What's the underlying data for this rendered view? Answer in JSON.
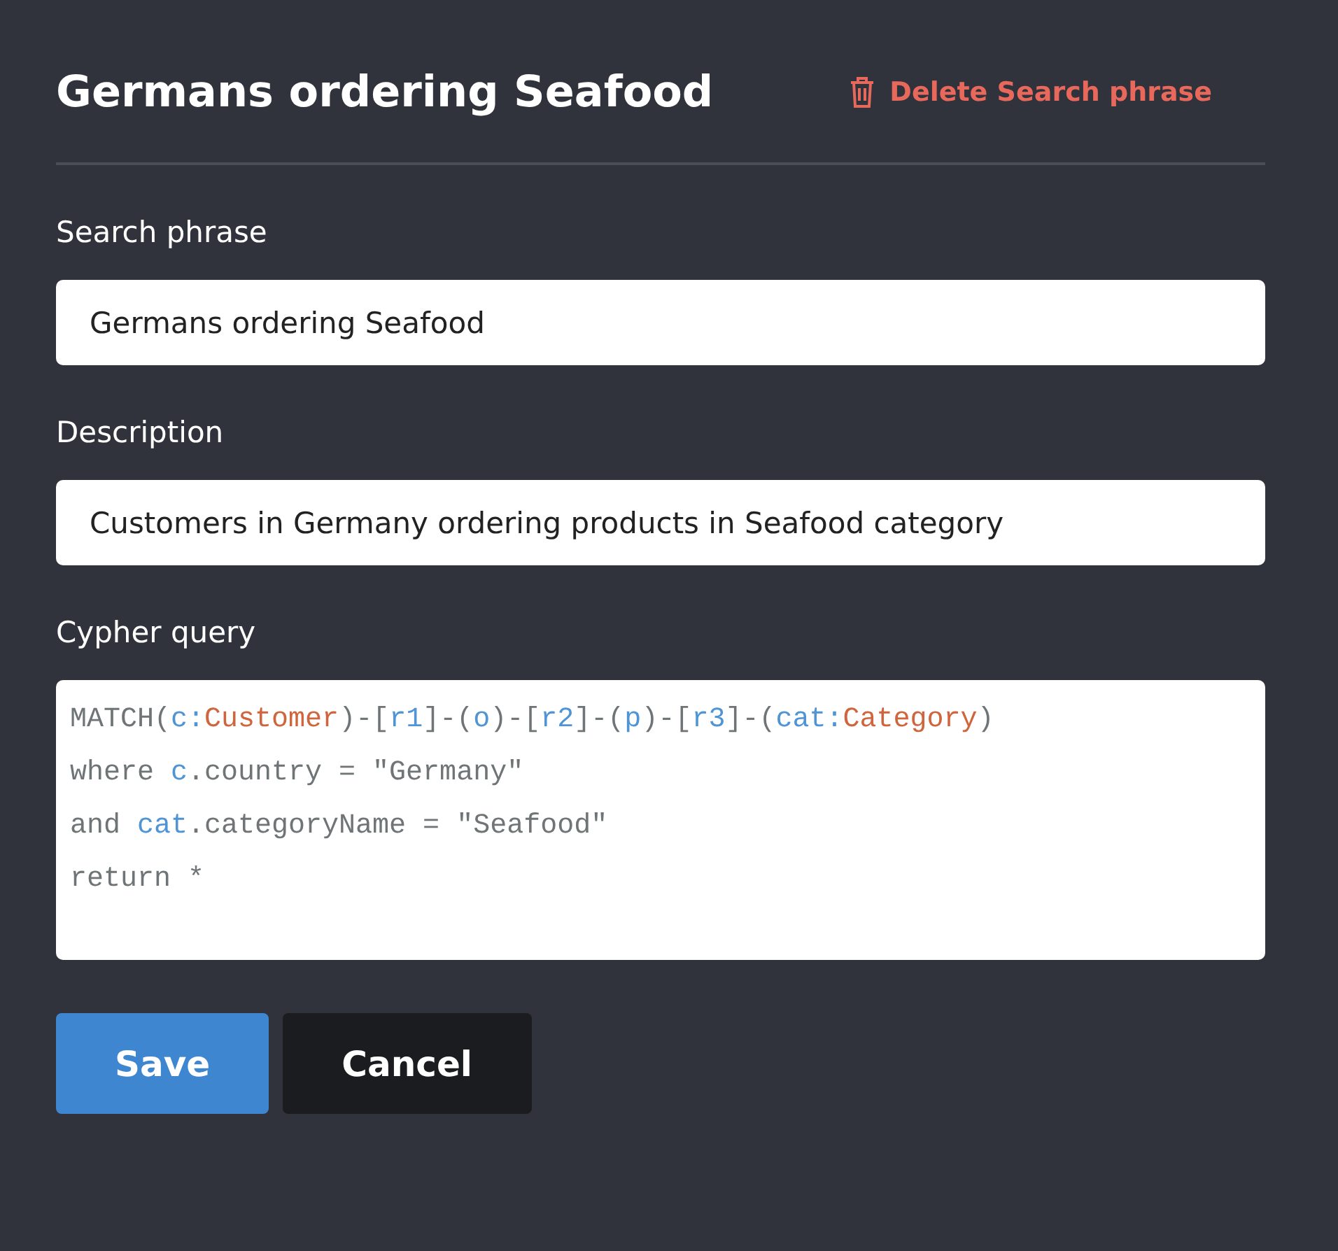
{
  "title": "Germans ordering Seafood",
  "delete_link": "Delete Search phrase",
  "fields": [
    {
      "label": "Search phrase",
      "value": "Germans ordering Seafood"
    },
    {
      "label": "Description",
      "value": "Customers in Germany ordering products in Seafood category"
    }
  ],
  "query": {
    "label": "Cypher query",
    "lines": [
      [
        {
          "text": "MATCH(",
          "kind": "plain"
        },
        {
          "text": "c",
          "kind": "variable"
        },
        {
          "text": ":",
          "kind": "variable"
        },
        {
          "text": "Customer",
          "kind": "label"
        },
        {
          "text": ")-[",
          "kind": "plain"
        },
        {
          "text": "r1",
          "kind": "variable"
        },
        {
          "text": "]-(",
          "kind": "plain"
        },
        {
          "text": "o",
          "kind": "variable"
        },
        {
          "text": ")-[",
          "kind": "plain"
        },
        {
          "text": "r2",
          "kind": "variable"
        },
        {
          "text": "]-(",
          "kind": "plain"
        },
        {
          "text": "p",
          "kind": "variable"
        },
        {
          "text": ")-[",
          "kind": "plain"
        },
        {
          "text": "r3",
          "kind": "variable"
        },
        {
          "text": "]-(",
          "kind": "plain"
        },
        {
          "text": "cat:",
          "kind": "variable"
        },
        {
          "text": "Category",
          "kind": "label"
        },
        {
          "text": ")",
          "kind": "plain"
        }
      ],
      [
        {
          "text": "where ",
          "kind": "plain"
        },
        {
          "text": "c",
          "kind": "variable"
        },
        {
          "text": ".country = \"Germany\"",
          "kind": "plain"
        }
      ],
      [
        {
          "text": "and ",
          "kind": "plain"
        },
        {
          "text": "cat",
          "kind": "variable"
        },
        {
          "text": ".categoryName = \"Seafood\"",
          "kind": "plain"
        }
      ],
      [
        {
          "text": "return *",
          "kind": "plain"
        }
      ]
    ]
  },
  "buttons": [
    {
      "label": "Save",
      "kind": "primary"
    },
    {
      "label": "Cancel",
      "kind": "secondary"
    }
  ]
}
